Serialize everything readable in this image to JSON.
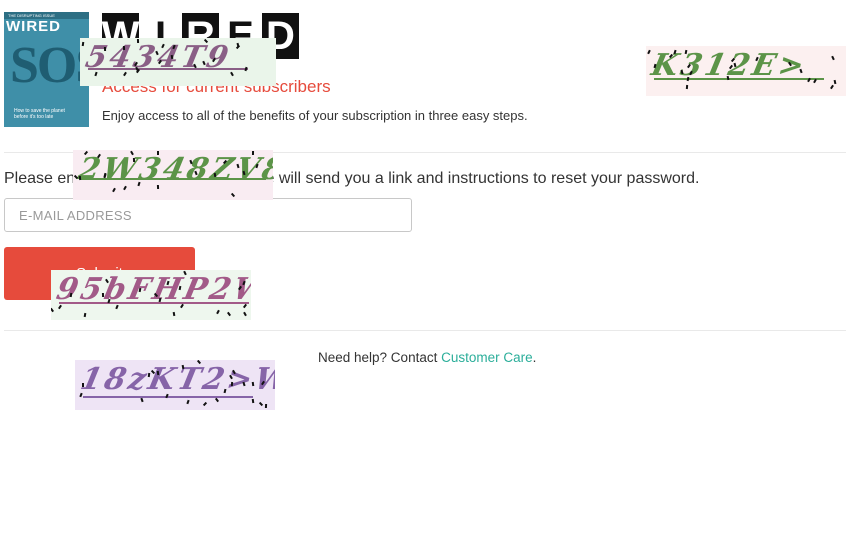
{
  "cover": {
    "top_banner": "THE DISRUPTING ISSUE",
    "brand": "WIRED",
    "headline": "SOS",
    "teaser": "How to save the planet before it's too late"
  },
  "logo": {
    "letters": [
      "W",
      "I",
      "R",
      "E",
      "D"
    ]
  },
  "header": {
    "subtitle": "Access for current subscribers",
    "intro": "Enjoy access to all of the benefits of your subscription in three easy steps."
  },
  "form": {
    "instructions": "Please enter your email below and we will send you a link and instructions to reset your password.",
    "email_placeholder": "E-MAIL ADDRESS",
    "submit_label": "Submit"
  },
  "help": {
    "prefix": "Need help? Contact ",
    "link": "Customer Care",
    "suffix": "."
  },
  "captchas": [
    {
      "text": "5434T9",
      "text_color": "#8a5f86",
      "bg_color": "#eaf5ea"
    },
    {
      "text": "K312E>",
      "text_color": "#5c9448",
      "bg_color": "#fcf0f0"
    },
    {
      "text": "2W348ZV8",
      "text_color": "#5c9448",
      "bg_color": "#f9ecf2"
    },
    {
      "text": "95bFHP2W",
      "text_color": "#a25a88",
      "bg_color": "#eef7ee"
    },
    {
      "text": "18zKT2>W",
      "text_color": "#8664a8",
      "bg_color": "#eee4f5"
    }
  ],
  "colors": {
    "accent": "#e64b3c",
    "link": "#2bae9a"
  }
}
